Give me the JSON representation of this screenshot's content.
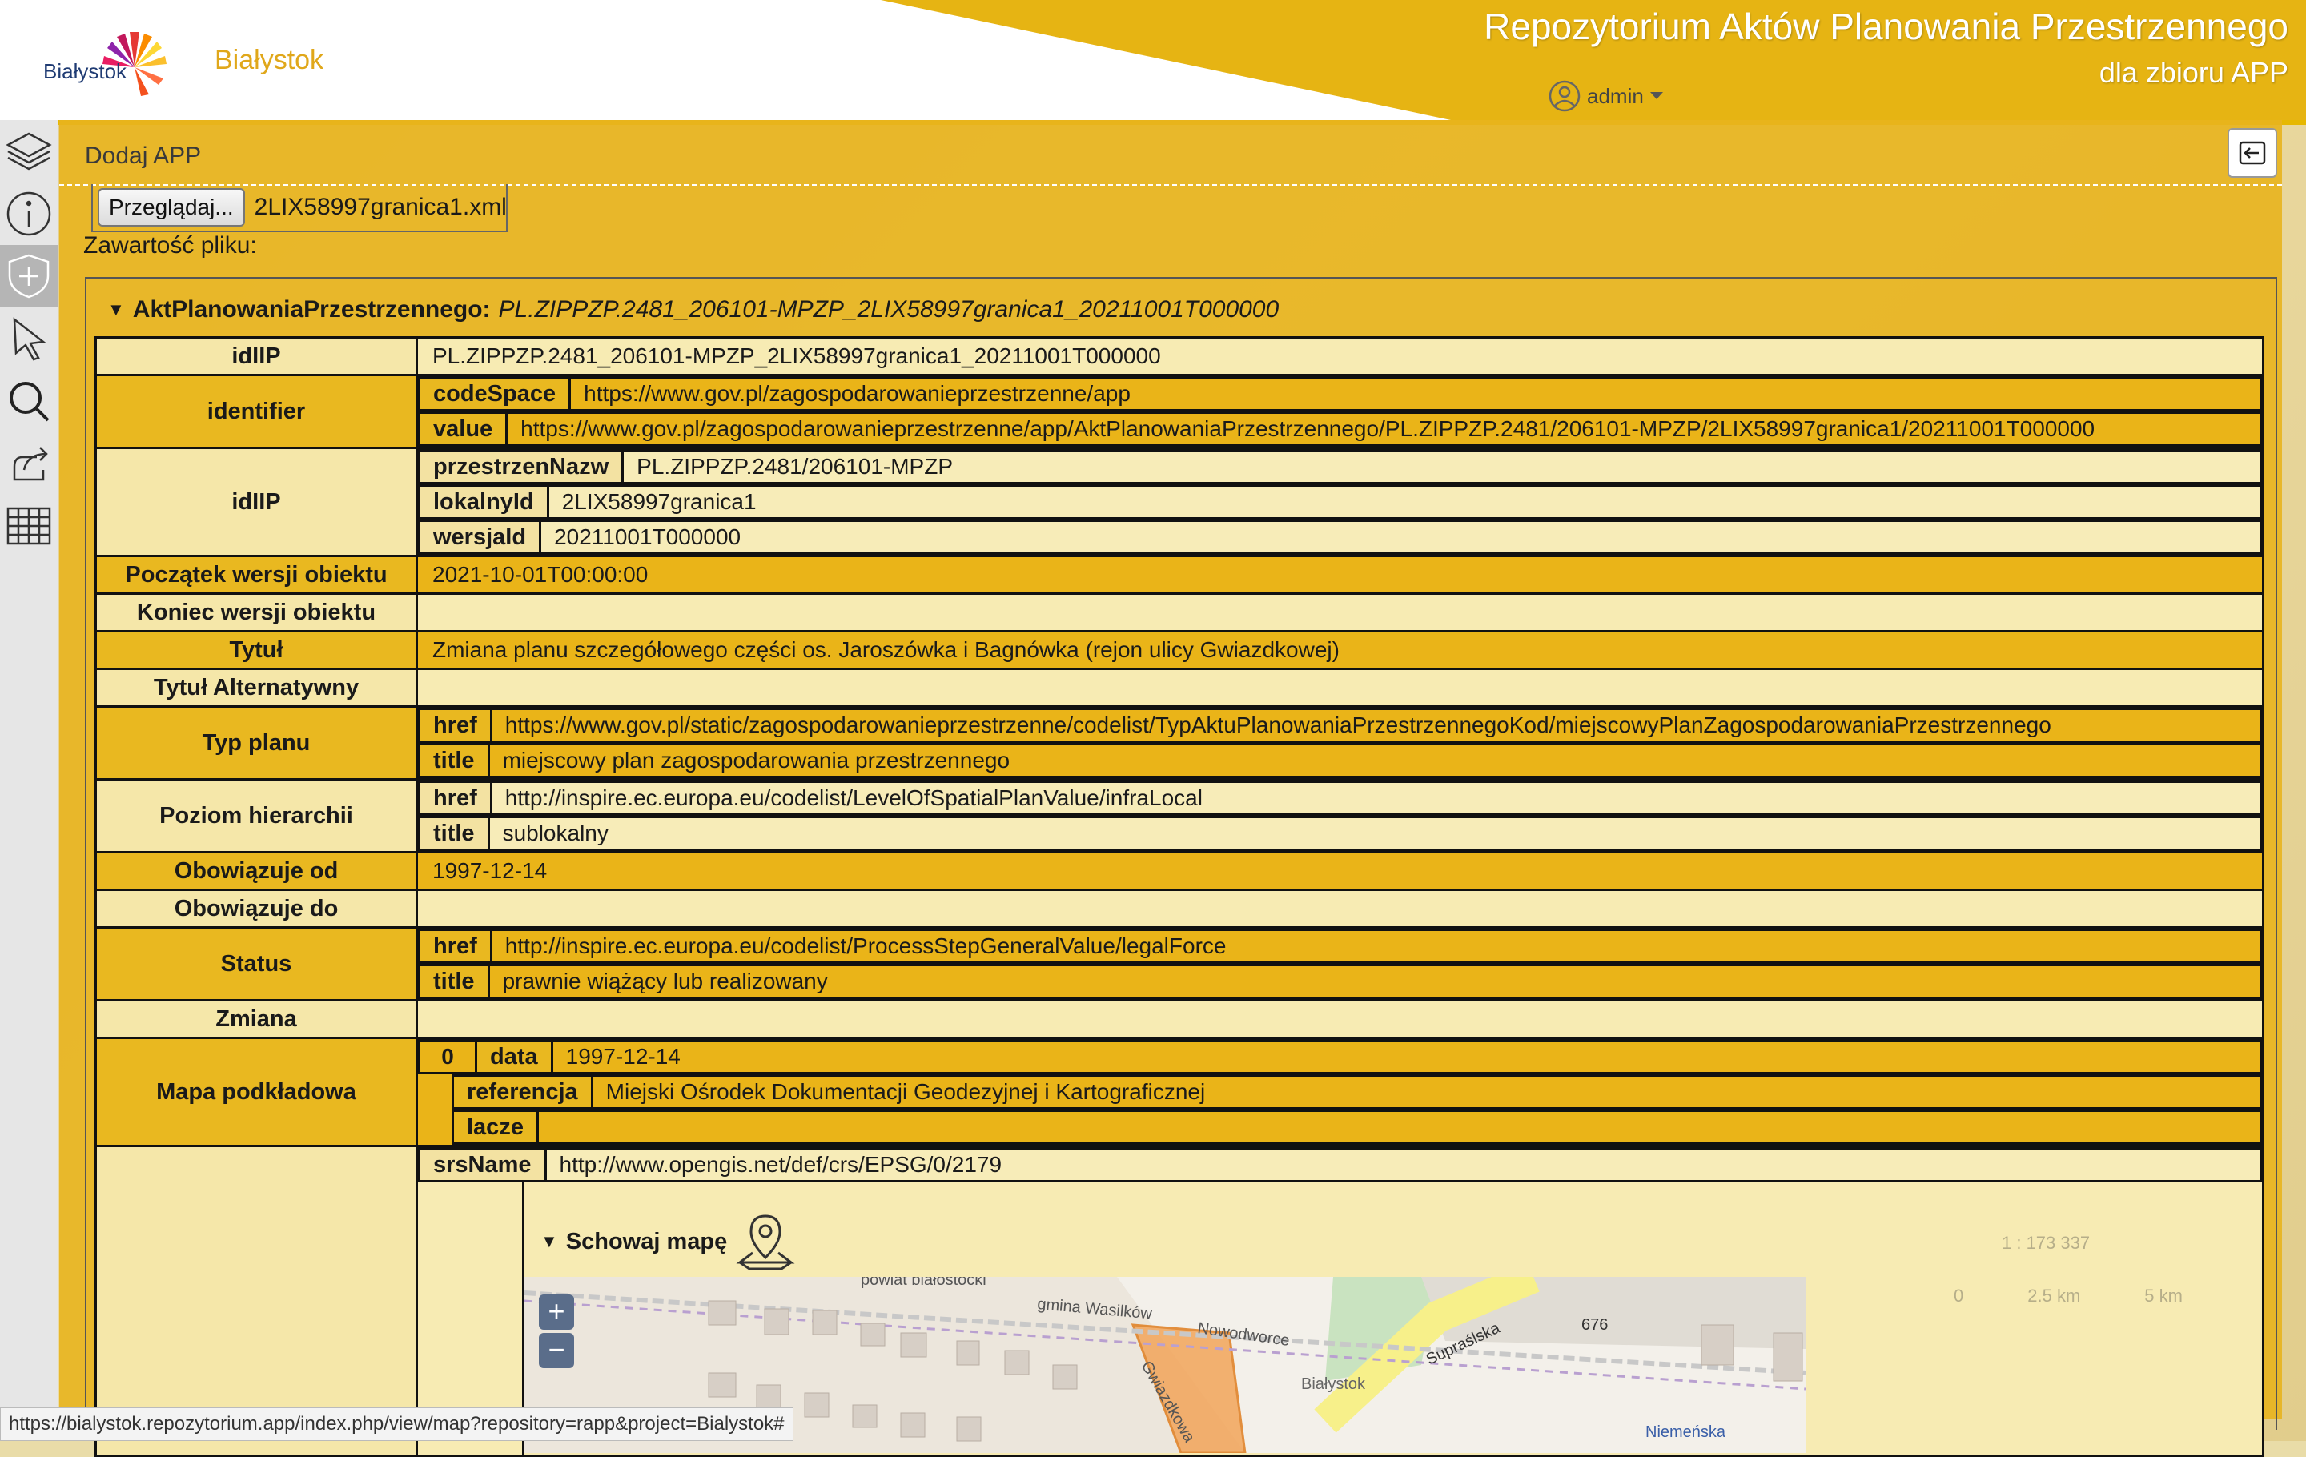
{
  "header": {
    "logo_text": "Białystok",
    "city": "Białystok",
    "title": "Repozytorium Aktów Planowania Przestrzennego",
    "subtitle": "dla zbioru APP",
    "user": "admin"
  },
  "toolbar": [
    "layers-icon",
    "info-icon",
    "add-shield-icon",
    "select-pointer-icon",
    "search-icon",
    "share-icon",
    "table-icon"
  ],
  "panel": {
    "title": "Dodaj APP",
    "browse_label": "Przeglądaj...",
    "file_name": "2LIX58997granica1.xml",
    "content_label": "Zawartość pliku:",
    "root_key": "AktPlanowaniaPrzestrzennego:",
    "root_value": "PL.ZIPPZP.2481_206101-MPZP_2LIX58997granica1_20211001T000000"
  },
  "rows": {
    "idIIP1_label": "idIIP",
    "idIIP1_value": "PL.ZIPPZP.2481_206101-MPZP_2LIX58997granica1_20211001T000000",
    "identifier_label": "identifier",
    "codeSpace_key": "codeSpace",
    "codeSpace_value": "https://www.gov.pl/zagospodarowanieprzestrzenne/app",
    "value_key": "value",
    "value_value": "https://www.gov.pl/zagospodarowanieprzestrzenne/app/AktPlanowaniaPrzestrzennego/PL.ZIPPZP.2481/206101-MPZP/2LIX58997granica1/20211001T000000",
    "idIIP2_label": "idIIP",
    "przestrzenNazw_key": "przestrzenNazw",
    "przestrzenNazw_value": "PL.ZIPPZP.2481/206101-MPZP",
    "lokalnyId_key": "lokalnyId",
    "lokalnyId_value": "2LIX58997granica1",
    "wersjaId_key": "wersjaId",
    "wersjaId_value": "20211001T000000",
    "poczatek_label": "Początek wersji obiektu",
    "poczatek_value": "2021-10-01T00:00:00",
    "koniec_label": "Koniec wersji obiektu",
    "koniec_value": "",
    "tytul_label": "Tytuł",
    "tytul_value": "Zmiana planu szczegółowego części os. Jaroszówka i Bagnówka (rejon ulicy Gwiazdkowej)",
    "tytulAlt_label": "Tytuł Alternatywny",
    "tytulAlt_value": "",
    "typ_label": "Typ planu",
    "typ_href": "https://www.gov.pl/static/zagospodarowanieprzestrzenne/codelist/TypAktuPlanowaniaPrzestrzennegoKod/miejscowyPlanZagospodarowaniaPrzestrzennego",
    "typ_title": "miejscowy plan zagospodarowania przestrzennego",
    "poziom_label": "Poziom hierarchii",
    "poziom_href": "http://inspire.ec.europa.eu/codelist/LevelOfSpatialPlanValue/infraLocal",
    "poziom_title": "sublokalny",
    "obowOd_label": "Obowiązuje od",
    "obowOd_value": "1997-12-14",
    "obowDo_label": "Obowiązuje do",
    "obowDo_value": "",
    "status_label": "Status",
    "status_href": "http://inspire.ec.europa.eu/codelist/ProcessStepGeneralValue/legalForce",
    "status_title": "prawnie wiążący lub realizowany",
    "zmiana_label": "Zmiana",
    "zmiana_value": "",
    "mapa_label": "Mapa podkładowa",
    "mapa_index": "0",
    "data_key": "data",
    "data_value": "1997-12-14",
    "referencja_key": "referencja",
    "referencja_value": "Miejski Ośrodek Dokumentacji Geodezyjnej i Kartograficznej",
    "lacze_key": "lacze",
    "lacze_value": "",
    "srsName_key": "srsName",
    "srsName_value": "http://www.opengis.net/def/crs/EPSG/0/2179",
    "href_key": "href",
    "title_key": "title"
  },
  "map": {
    "toggle_label": "Schowaj mapę",
    "zoom_in": "+",
    "zoom_out": "−",
    "labels": [
      "powiat białostocki",
      "gmina Wasilków",
      "Nowodworce",
      "Gwiazdkowa",
      "Supraślska",
      "676",
      "Białystok",
      "Niemeńska"
    ],
    "scale_text": "1 : 173 337",
    "scale_ticks": [
      "0",
      "2.5 km",
      "5 km"
    ]
  },
  "statusbar": {
    "url": "https://bialystok.repozytorium.app/index.php/view/map?repository=rapp&project=Bialystok#"
  }
}
